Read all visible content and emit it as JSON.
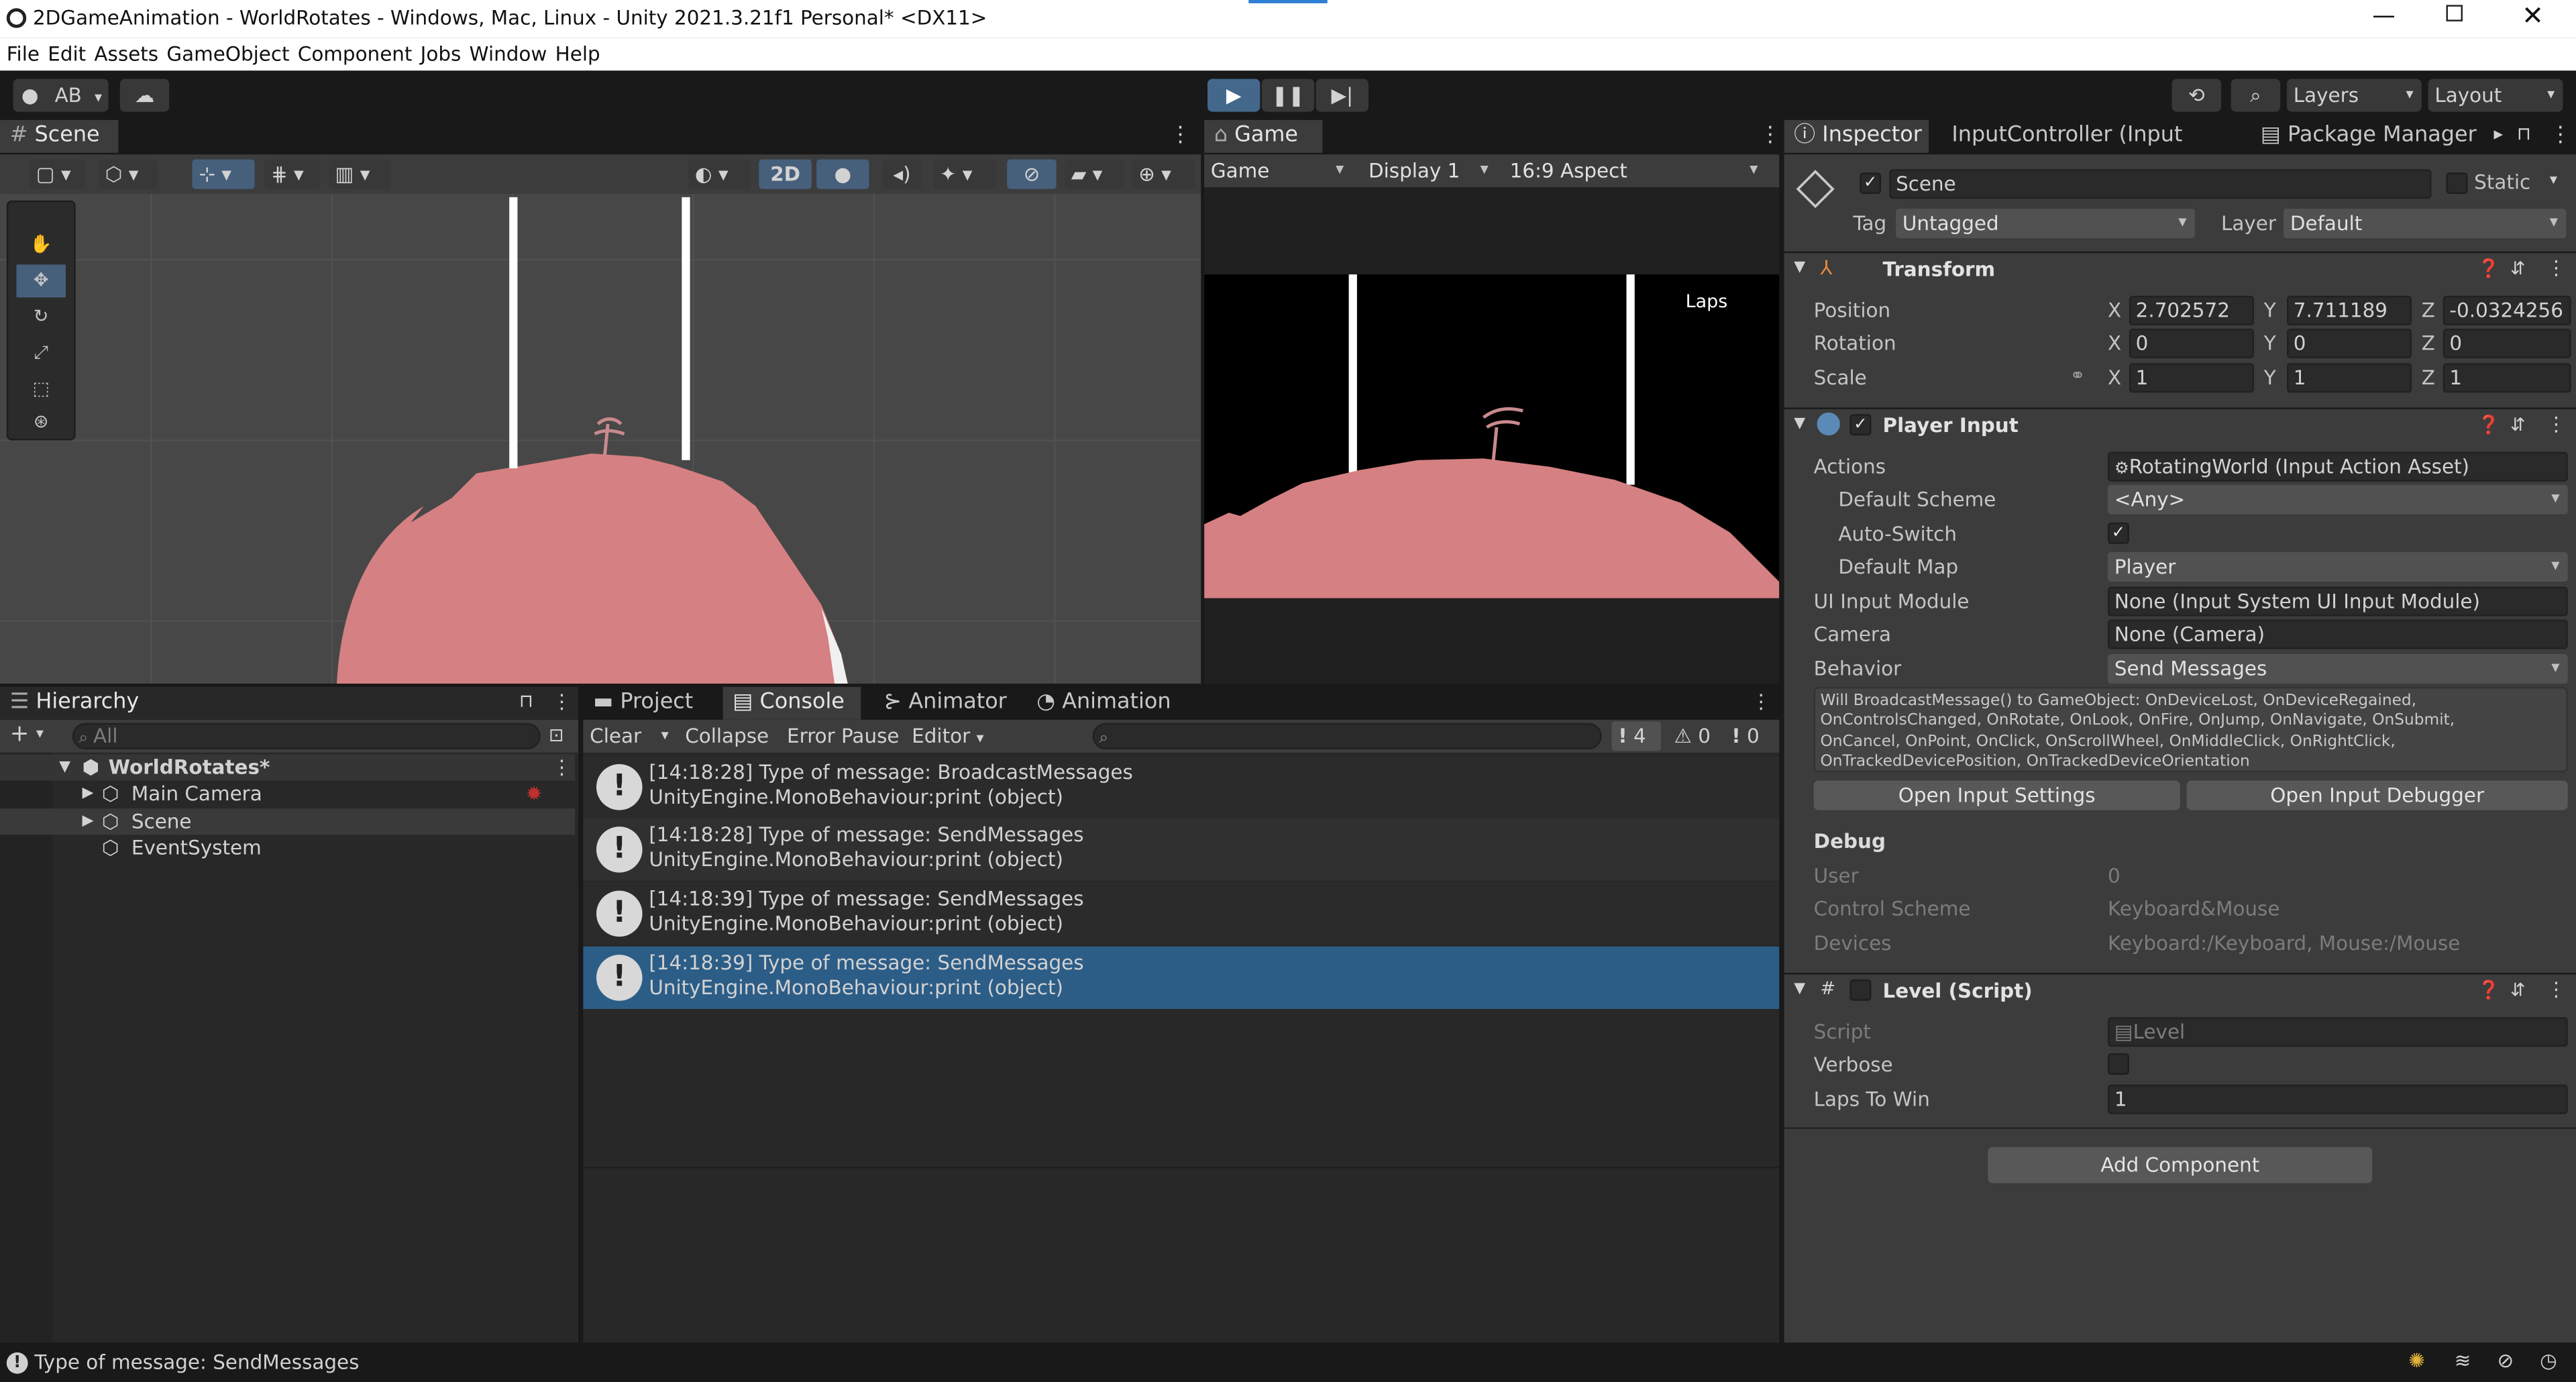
{
  "window": {
    "title": "2DGameAnimation - WorldRotates - Windows, Mac, Linux - Unity 2021.3.21f1 Personal* <DX11>"
  },
  "menu": [
    "File",
    "Edit",
    "Assets",
    "GameObject",
    "Component",
    "Jobs",
    "Window",
    "Help"
  ],
  "toolbar": {
    "account": "AB",
    "layers": "Layers",
    "layout": "Layout"
  },
  "scene": {
    "tab": "Scene",
    "mode_2d": "2D"
  },
  "game": {
    "tab": "Game",
    "view": "Game",
    "display": "Display 1",
    "aspect": "16:9 Aspect",
    "laps_label": "Laps"
  },
  "inspector": {
    "tabs": [
      "Inspector",
      "InputController (Input Acti...",
      "Package Manager"
    ],
    "object_name": "Scene",
    "static_label": "Static",
    "tag_label": "Tag",
    "tag_value": "Untagged",
    "layer_label": "Layer",
    "layer_value": "Default",
    "transform": {
      "title": "Transform",
      "position": {
        "label": "Position",
        "x": "2.702572",
        "y": "7.711189",
        "z": "-0.0324256"
      },
      "rotation": {
        "label": "Rotation",
        "x": "0",
        "y": "0",
        "z": "0"
      },
      "scale": {
        "label": "Scale",
        "x": "1",
        "y": "1",
        "z": "1"
      },
      "axis_x": "X",
      "axis_y": "Y",
      "axis_z": "Z"
    },
    "player_input": {
      "title": "Player Input",
      "actions_label": "Actions",
      "actions_value": "RotatingWorld (Input Action Asset)",
      "default_scheme_label": "Default Scheme",
      "default_scheme_value": "<Any>",
      "auto_switch_label": "Auto-Switch",
      "default_map_label": "Default Map",
      "default_map_value": "Player",
      "ui_module_label": "UI Input Module",
      "ui_module_value": "None (Input System UI Input Module)",
      "camera_label": "Camera",
      "camera_value": "None (Camera)",
      "behavior_label": "Behavior",
      "behavior_value": "Send Messages",
      "help_lines": [
        "Will BroadcastMessage() to GameObject: OnDeviceLost, OnDeviceRegained,",
        "OnControlsChanged, OnRotate, OnLook, OnFire, OnJump, OnNavigate, OnSubmit,",
        "OnCancel, OnPoint, OnClick, OnScrollWheel, OnMiddleClick, OnRightClick,",
        "OnTrackedDevicePosition, OnTrackedDeviceOrientation"
      ],
      "open_settings": "Open Input Settings",
      "open_debugger": "Open Input Debugger",
      "debug_title": "Debug",
      "user_label": "User",
      "user_value": "0",
      "control_scheme_label": "Control Scheme",
      "control_scheme_value": "Keyboard&Mouse",
      "devices_label": "Devices",
      "devices_value": "Keyboard:/Keyboard, Mouse:/Mouse"
    },
    "level": {
      "title": "Level (Script)",
      "script_label": "Script",
      "script_value": "Level",
      "verbose_label": "Verbose",
      "laps_label": "Laps To Win",
      "laps_value": "1"
    },
    "add_component": "Add Component"
  },
  "hierarchy": {
    "tab": "Hierarchy",
    "search_placeholder": "All",
    "root": "WorldRotates*",
    "items": [
      "Main Camera",
      "Scene",
      "EventSystem"
    ]
  },
  "bottom_tabs": [
    "Project",
    "Console",
    "Animator",
    "Animation"
  ],
  "console": {
    "clear": "Clear",
    "collapse": "Collapse",
    "error_pause": "Error Pause",
    "editor": "Editor",
    "count_info": "4",
    "count_warn": "0",
    "count_error": "0",
    "messages": [
      {
        "line1": "[14:18:28] Type of message: BroadcastMessages",
        "line2": "UnityEngine.MonoBehaviour:print (object)"
      },
      {
        "line1": "[14:18:28] Type of message: SendMessages",
        "line2": "UnityEngine.MonoBehaviour:print (object)"
      },
      {
        "line1": "[14:18:39] Type of message: SendMessages",
        "line2": "UnityEngine.MonoBehaviour:print (object)"
      },
      {
        "line1": "[14:18:39] Type of message: SendMessages",
        "line2": "UnityEngine.MonoBehaviour:print (object)"
      }
    ]
  },
  "status": {
    "text": "Type of message: SendMessages"
  },
  "colors": {
    "accent": "#2c5d87",
    "ground": "#d58082",
    "scene_bg": "#474747"
  }
}
